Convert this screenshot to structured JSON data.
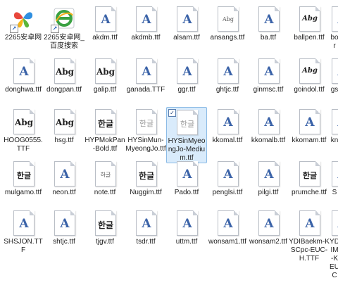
{
  "colors": {
    "selection_bg": "#d9ebfb",
    "selection_border": "#8cbbe6",
    "font_glyph": "#3b63a8"
  },
  "rows": [
    [
      {
        "label": "2265安卓网",
        "icon": "butterfly-shortcut-icon",
        "type": "shortcut"
      },
      {
        "label": "2265安卓网_百度搜索",
        "icon": "ie-shortcut-icon",
        "type": "shortcut"
      },
      {
        "label": "akdm.ttf",
        "icon": "font-file-icon",
        "glyph": "A"
      },
      {
        "label": "akdmb.ttf",
        "icon": "font-file-icon",
        "glyph": "A"
      },
      {
        "label": "alsam.ttf",
        "icon": "font-file-icon",
        "glyph": "A"
      },
      {
        "label": "ansangs.ttf",
        "icon": "font-file-icon",
        "glyph": "Abg",
        "style": "tiny"
      },
      {
        "label": "ba.ttf",
        "icon": "font-file-icon",
        "glyph": "A"
      },
      {
        "label": "ballpen.ttf",
        "icon": "font-file-icon",
        "glyph": "Abg",
        "style": "script"
      },
      {
        "label": "bor",
        "icon": "font-file-icon",
        "glyph": "A"
      }
    ],
    [
      {
        "label": "donghwa.ttf",
        "icon": "font-file-icon",
        "glyph": "A"
      },
      {
        "label": "dongpan.ttf",
        "icon": "font-file-icon",
        "glyph": "Abg",
        "style": "bold"
      },
      {
        "label": "galip.ttf",
        "icon": "font-file-icon",
        "glyph": "Abg",
        "style": "bold"
      },
      {
        "label": "ganada.TTF",
        "icon": "font-file-icon",
        "glyph": "A"
      },
      {
        "label": "ggr.ttf",
        "icon": "font-file-icon",
        "glyph": "A"
      },
      {
        "label": "ghtjc.ttf",
        "icon": "font-file-icon",
        "glyph": "A"
      },
      {
        "label": "ginmsc.ttf",
        "icon": "font-file-icon",
        "glyph": "A"
      },
      {
        "label": "goindol.ttf",
        "icon": "font-file-icon",
        "glyph": "Abg",
        "style": "script"
      },
      {
        "label": "gs",
        "icon": "font-file-icon",
        "glyph": "A"
      }
    ],
    [
      {
        "label": "HOOG0555.TTF",
        "icon": "font-file-icon",
        "glyph": "Abg",
        "style": "bold"
      },
      {
        "label": "hsg.ttf",
        "icon": "font-file-icon",
        "glyph": "Abg",
        "style": "bold"
      },
      {
        "label": "HYPMokPan-Bold.ttf",
        "icon": "font-file-icon",
        "glyph": "한글",
        "style": "bold"
      },
      {
        "label": "HYSinMun-MyeongJo.ttf",
        "icon": "font-file-icon",
        "glyph": "한글",
        "style": "faint"
      },
      {
        "label": "HYSinMyeongJo-Medium.ttf",
        "icon": "font-file-icon",
        "glyph": "한글",
        "style": "faint",
        "selected": true
      },
      {
        "label": "kkomal.ttf",
        "icon": "font-file-icon",
        "glyph": "A"
      },
      {
        "label": "kkomalb.ttf",
        "icon": "font-file-icon",
        "glyph": "A"
      },
      {
        "label": "kkomam.ttf",
        "icon": "font-file-icon",
        "glyph": "A"
      },
      {
        "label": "kn",
        "icon": "font-file-icon",
        "glyph": "A"
      }
    ],
    [
      {
        "label": "mulgamo.ttf",
        "icon": "font-file-icon",
        "glyph": "한글",
        "style": "normal"
      },
      {
        "label": "neon.ttf",
        "icon": "font-file-icon",
        "glyph": "A"
      },
      {
        "label": "note.ttf",
        "icon": "font-file-icon",
        "glyph": "하글",
        "style": "tiny"
      },
      {
        "label": "Nuggim.ttf",
        "icon": "font-file-icon",
        "glyph": "한글",
        "style": "bold"
      },
      {
        "label": "Pado.ttf",
        "icon": "font-file-icon",
        "glyph": "A"
      },
      {
        "label": "penglsi.ttf",
        "icon": "font-file-icon",
        "glyph": "A"
      },
      {
        "label": "pilgi.ttf",
        "icon": "font-file-icon",
        "glyph": "A"
      },
      {
        "label": "prumche.ttf",
        "icon": "font-file-icon",
        "glyph": "한글",
        "style": "normal"
      },
      {
        "label": "S",
        "icon": "font-file-icon",
        "glyph": "A"
      }
    ],
    [
      {
        "label": "SHSJON.TTF",
        "icon": "font-file-icon",
        "glyph": "A"
      },
      {
        "label": "shtjc.ttf",
        "icon": "font-file-icon",
        "glyph": "A"
      },
      {
        "label": "tjgv.ttf",
        "icon": "font-file-icon",
        "glyph": "한글",
        "style": "bold"
      },
      {
        "label": "tsdr.ttf",
        "icon": "font-file-icon",
        "glyph": "A"
      },
      {
        "label": "uttm.ttf",
        "icon": "font-file-icon",
        "glyph": "A"
      },
      {
        "label": "wonsam1.ttf",
        "icon": "font-file-icon",
        "glyph": "A"
      },
      {
        "label": "wonsam2.ttf",
        "icon": "font-file-icon",
        "glyph": "A"
      },
      {
        "label": "YDIBaekm-KSCpc-EUC-H.TTF",
        "icon": "font-file-icon",
        "glyph": "A"
      },
      {
        "label": "YDIM-KEUC",
        "icon": "font-file-icon",
        "glyph": "A"
      }
    ]
  ]
}
